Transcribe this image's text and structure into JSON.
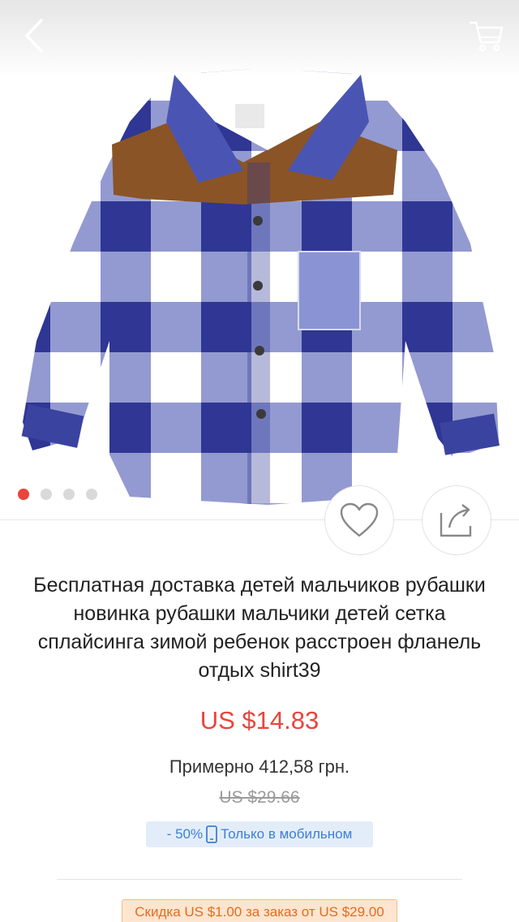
{
  "header": {
    "back_icon": "chevron-left-icon",
    "cart_icon": "shopping-cart-icon"
  },
  "gallery": {
    "image_count": 4,
    "active_index": 0,
    "colors": {
      "active_dot": "#e8453c",
      "inactive_dot": "#d9d9d9"
    }
  },
  "actions": {
    "wishlist_icon": "heart-outline-icon",
    "share_icon": "share-icon"
  },
  "product": {
    "title": "Бесплатная доставка детей мальчиков рубашки новинка рубашки мальчики детей сетка сплайсинга зимой ребенок расстроен фланель отдых shirt39",
    "price": "US $14.83",
    "approx_price": "Примерно 412,58 грн.",
    "old_price": "US $29.66",
    "mobile_discount": "- 50%",
    "mobile_only_label": "Только в мобильном",
    "coupon": "Скидка US $1.00 за заказ от US $29.00"
  },
  "colors": {
    "price": "#e8453c",
    "mobile_badge_bg": "#e3edf9",
    "mobile_badge_text": "#3d7fd6",
    "coupon_bg": "#fde5cf",
    "coupon_text": "#e56b1f"
  }
}
